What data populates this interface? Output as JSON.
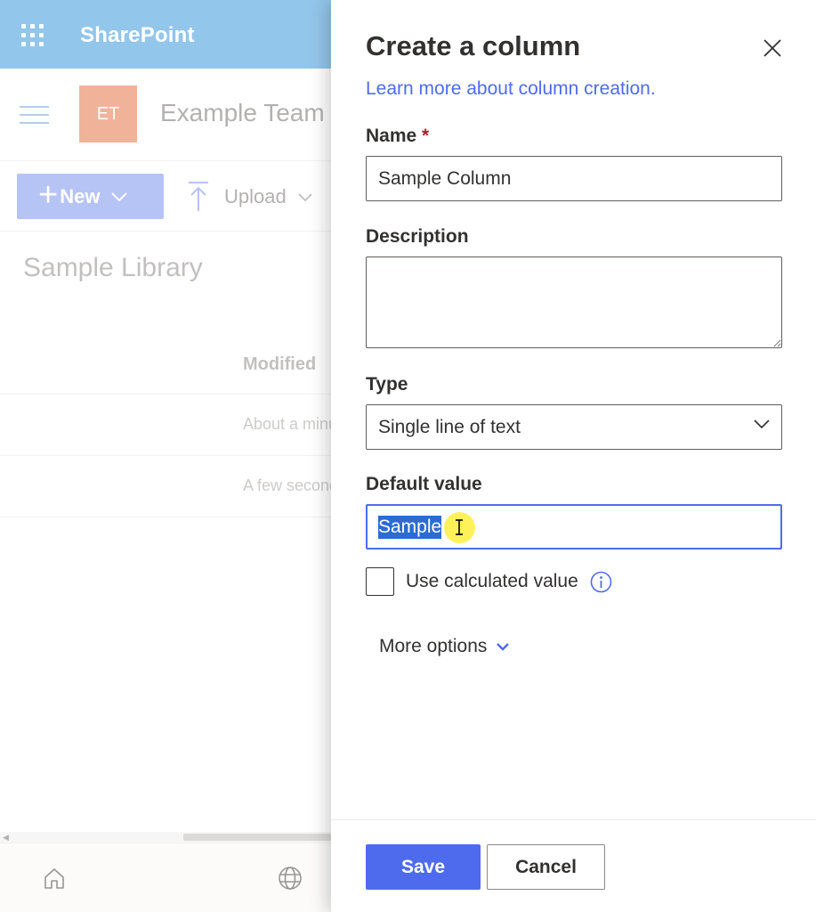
{
  "suite_bar": {
    "brand": "SharePoint",
    "launcher_icon": "waffle-icon",
    "color": "#5aa8e0"
  },
  "site": {
    "logo_initials": "ET",
    "logo_color": "#e88a64",
    "title": "Example Team S"
  },
  "command_bar": {
    "new_label": "New",
    "upload_label": "Upload"
  },
  "library": {
    "title": "Sample Library",
    "columns": [
      "Modified"
    ],
    "rows": [
      {
        "modified": "About a minute ago"
      },
      {
        "modified": "A few seconds ago"
      }
    ]
  },
  "bottom_nav": {
    "icons": [
      "home-icon",
      "globe-icon"
    ]
  },
  "panel": {
    "title": "Create a column",
    "learn_more_link": "Learn more about column creation.",
    "name": {
      "label": "Name",
      "required_marker": "*",
      "value": "Sample Column"
    },
    "description": {
      "label": "Description",
      "value": ""
    },
    "type": {
      "label": "Type",
      "selected": "Single line of text"
    },
    "default_value": {
      "label": "Default value",
      "value": "Sample"
    },
    "calculated": {
      "label": "Use calculated value",
      "checked": false
    },
    "more_options_label": "More options",
    "save_label": "Save",
    "cancel_label": "Cancel",
    "accent_color": "#4f6bed"
  }
}
